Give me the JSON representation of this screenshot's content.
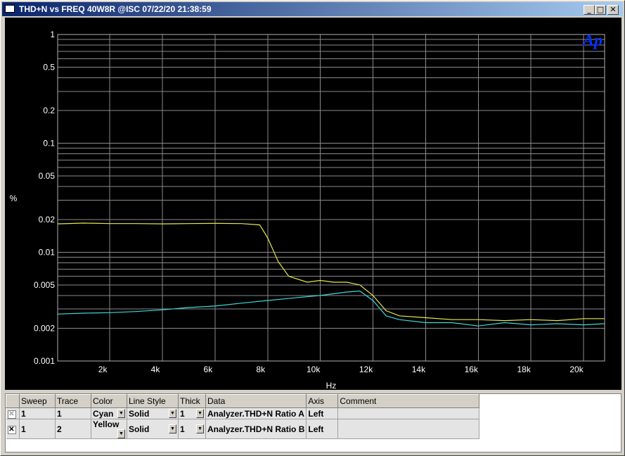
{
  "window": {
    "title": "THD+N vs FREQ 40W8R @ISC  07/22/20 21:38:59",
    "buttons": {
      "minimize": "_",
      "maximize": "□",
      "close": "✕"
    }
  },
  "logo": "Ap",
  "chart_data": {
    "type": "line",
    "xlabel": "Hz",
    "ylabel": "%",
    "x_scale": "linear",
    "y_scale": "log",
    "xlim": [
      20,
      20800
    ],
    "ylim": [
      0.001,
      1
    ],
    "x_ticks": [
      {
        "v": 2000,
        "label": "2k"
      },
      {
        "v": 4000,
        "label": "4k"
      },
      {
        "v": 6000,
        "label": "6k"
      },
      {
        "v": 8000,
        "label": "8k"
      },
      {
        "v": 10000,
        "label": "10k"
      },
      {
        "v": 12000,
        "label": "12k"
      },
      {
        "v": 14000,
        "label": "14k"
      },
      {
        "v": 16000,
        "label": "16k"
      },
      {
        "v": 18000,
        "label": "18k"
      },
      {
        "v": 20000,
        "label": "20k"
      }
    ],
    "y_ticks": [
      {
        "v": 1,
        "label": "1"
      },
      {
        "v": 0.5,
        "label": "0.5"
      },
      {
        "v": 0.2,
        "label": "0.2"
      },
      {
        "v": 0.1,
        "label": "0.1"
      },
      {
        "v": 0.05,
        "label": "0.05"
      },
      {
        "v": 0.02,
        "label": "0.02"
      },
      {
        "v": 0.01,
        "label": "0.01"
      },
      {
        "v": 0.005,
        "label": "0.005"
      },
      {
        "v": 0.002,
        "label": "0.002"
      },
      {
        "v": 0.001,
        "label": "0.001"
      }
    ],
    "grid": true,
    "series": [
      {
        "name": "Analyzer.THD+N Ratio A",
        "color": "#3fd8d8",
        "x": [
          20,
          1000,
          2000,
          3000,
          4000,
          5000,
          6000,
          7000,
          8000,
          9000,
          10000,
          11000,
          11500,
          12000,
          12500,
          13000,
          14000,
          15000,
          16000,
          17000,
          18000,
          19000,
          20000,
          20800
        ],
        "y": [
          0.0027,
          0.00275,
          0.00278,
          0.00285,
          0.00295,
          0.0031,
          0.0032,
          0.0034,
          0.0036,
          0.0038,
          0.004,
          0.0043,
          0.0044,
          0.0036,
          0.0026,
          0.0024,
          0.00225,
          0.00225,
          0.0021,
          0.00225,
          0.00215,
          0.0022,
          0.00215,
          0.0022
        ]
      },
      {
        "name": "Analyzer.THD+N Ratio B",
        "color": "#e8e84a",
        "x": [
          20,
          1000,
          2000,
          3000,
          4000,
          5000,
          6000,
          7000,
          7700,
          8000,
          8400,
          8800,
          9500,
          10000,
          10500,
          11000,
          11500,
          12000,
          12500,
          13000,
          14000,
          15000,
          16000,
          17000,
          18000,
          19000,
          20000,
          20800
        ],
        "y": [
          0.0182,
          0.0185,
          0.0183,
          0.0183,
          0.0182,
          0.0183,
          0.0184,
          0.0183,
          0.0178,
          0.0135,
          0.0082,
          0.006,
          0.0053,
          0.0055,
          0.0053,
          0.0053,
          0.005,
          0.004,
          0.0029,
          0.0026,
          0.0025,
          0.0024,
          0.0024,
          0.00235,
          0.0024,
          0.00235,
          0.00245,
          0.00245
        ]
      }
    ]
  },
  "trace_table": {
    "columns": [
      "Sweep",
      "Trace",
      "Color",
      "Line Style",
      "Thick",
      "Data",
      "Axis",
      "Comment"
    ],
    "rows": [
      {
        "checked": "✕",
        "sweep": "1",
        "trace": "1",
        "color": "Cyan",
        "line_style": "Solid",
        "thick": "1",
        "data": "Analyzer.THD+N Ratio A",
        "axis": "Left",
        "comment": ""
      },
      {
        "checked": "✕",
        "sweep": "1",
        "trace": "2",
        "color": "Yellow",
        "line_style": "Solid",
        "thick": "1",
        "data": "Analyzer.THD+N Ratio B",
        "axis": "Left",
        "comment": ""
      }
    ]
  }
}
